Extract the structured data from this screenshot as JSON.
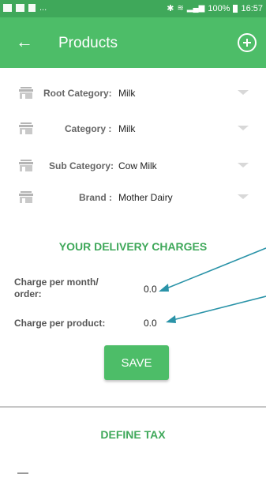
{
  "status_bar": {
    "left_text": "...",
    "signal_text": "100%",
    "time": "16:57"
  },
  "appbar": {
    "title": "Products"
  },
  "filters": [
    {
      "label": "Root Category:",
      "value": "Milk"
    },
    {
      "label": "Category :",
      "value": "Milk"
    },
    {
      "label": "Sub Category:",
      "value": "Cow Milk"
    },
    {
      "label": "Brand :",
      "value": "Mother Dairy"
    }
  ],
  "delivery": {
    "title": "YOUR DELIVERY CHARGES",
    "per_month_label_line1": "Charge per month/",
    "per_month_label_line2": "order:",
    "per_month_value": "0.0",
    "per_product_label": "Charge per product:",
    "per_product_value": "0.0",
    "save_label": "SAVE"
  },
  "tax": {
    "title": "DEFINE TAX"
  },
  "colors": {
    "primary": "#4dbd68",
    "status": "#3fa85a",
    "arrow": "#2a93a8"
  }
}
